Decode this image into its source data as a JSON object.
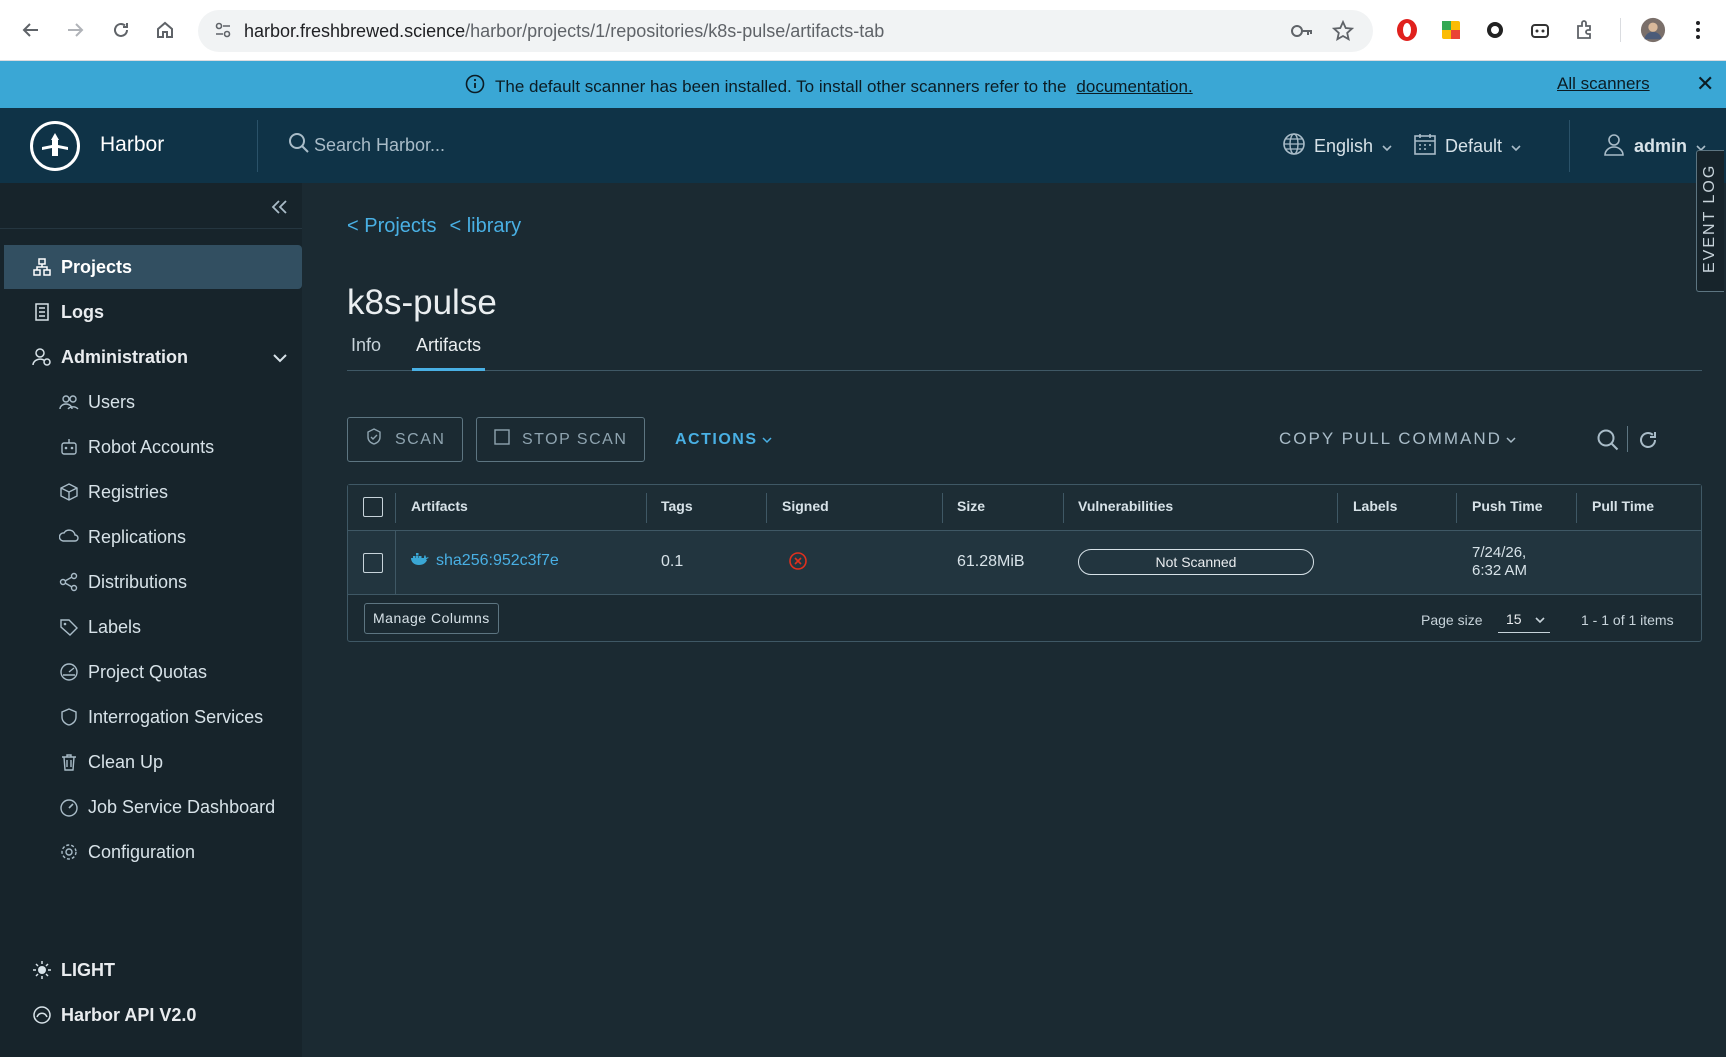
{
  "browser": {
    "url_host": "harbor.freshbrewed.science",
    "url_path": "/harbor/projects/1/repositories/k8s-pulse/artifacts-tab"
  },
  "banner": {
    "message": "The default scanner has been installed. To install other scanners refer to the",
    "link": "documentation.",
    "right_link": "All scanners",
    "color": "#3aa7d5"
  },
  "header": {
    "brand": "Harbor",
    "search_placeholder": "Search Harbor...",
    "language": "English",
    "theme": "Default",
    "user": "admin"
  },
  "sidebar": {
    "items": [
      {
        "label": "Projects",
        "icon": "projects-icon"
      },
      {
        "label": "Logs",
        "icon": "logs-icon"
      },
      {
        "label": "Administration",
        "icon": "administration-icon"
      }
    ],
    "admin_items": [
      {
        "label": "Users",
        "icon": "users-icon"
      },
      {
        "label": "Robot Accounts",
        "icon": "robot-icon"
      },
      {
        "label": "Registries",
        "icon": "registries-icon"
      },
      {
        "label": "Replications",
        "icon": "replications-icon"
      },
      {
        "label": "Distributions",
        "icon": "distributions-icon"
      },
      {
        "label": "Labels",
        "icon": "labels-icon"
      },
      {
        "label": "Project Quotas",
        "icon": "quotas-icon"
      },
      {
        "label": "Interrogation Services",
        "icon": "shield-icon"
      },
      {
        "label": "Clean Up",
        "icon": "trash-icon"
      },
      {
        "label": "Job Service Dashboard",
        "icon": "dashboard-icon"
      },
      {
        "label": "Configuration",
        "icon": "gear-icon"
      }
    ],
    "bottom": [
      {
        "label": "LIGHT",
        "icon": "sun-icon"
      },
      {
        "label": "Harbor API V2.0",
        "icon": "api-icon"
      }
    ]
  },
  "main": {
    "breadcrumbs": [
      "< Projects",
      "< library"
    ],
    "title": "k8s-pulse",
    "tabs": [
      "Info",
      "Artifacts"
    ],
    "active_tab": "Artifacts",
    "toolbar": {
      "scan": "SCAN",
      "stop_scan": "STOP SCAN",
      "actions": "ACTIONS",
      "copy_pull": "COPY PULL COMMAND"
    },
    "table": {
      "columns": [
        "Artifacts",
        "Tags",
        "Signed",
        "Size",
        "Vulnerabilities",
        "Labels",
        "Push Time",
        "Pull Time"
      ],
      "rows": [
        {
          "artifact": "sha256:952c3f7e",
          "tags": "0.1",
          "signed": "not-signed-icon",
          "size": "61.28MiB",
          "vulnerabilities": "Not Scanned",
          "labels": "",
          "push_time_1": "7/24/26,",
          "push_time_2": "6:32 AM",
          "pull_time": ""
        }
      ],
      "manage_columns": "Manage Columns",
      "page_size_label": "Page size",
      "page_size": "15",
      "count": "1 - 1 of 1 items"
    },
    "event_log": "EVENT LOG"
  }
}
